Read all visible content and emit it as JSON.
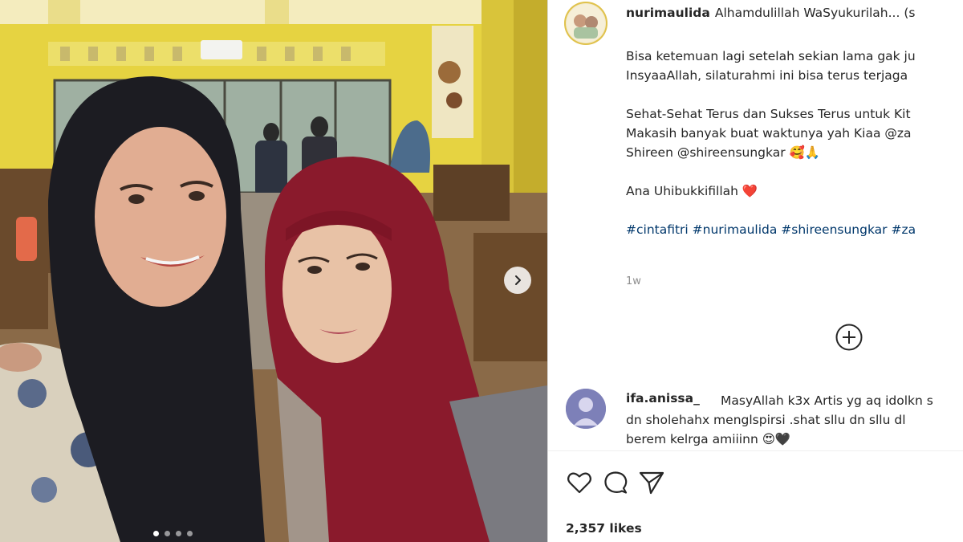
{
  "post": {
    "username": "nurimaulida",
    "caption_head": "Alhamdulillah WaSyukurilah... (s",
    "caption_lines": [
      "Bisa ketemuan lagi setelah sekian lama gak ju",
      "InsyaaAllah, silaturahmi ini bisa terus terjaga",
      "",
      "Sehat-Sehat Terus dan Sukses Terus untuk Kit",
      "Makasih banyak buat waktunya yah Kiaa @za",
      "Shireen @shireensungkar 🥰🙏",
      "",
      "Ana Uhibukkifillah ❤️",
      "",
      "#cintafitri #nurimaulida #shireensungkar #za"
    ],
    "time": "1w",
    "likes": "2,357 likes"
  },
  "comment": {
    "username": "ifa.anissa_",
    "lines": [
      "MasyAllah k3x Artis yg aq idolkn s",
      "dn sholehahx menglspirsi .shat sllu dn sllu dl",
      "berem kelrga amiiinn 😍🖤"
    ]
  },
  "icons": {
    "like": "heart-icon",
    "comment": "comment-icon",
    "share": "send-icon",
    "load_more": "plus-circle-icon",
    "next": "chevron-right-icon"
  },
  "carousel": {
    "count": 4,
    "active_index": 0
  },
  "colors": {
    "wall": "#e6d341",
    "hijab_dark": "#1c1c22",
    "hijab_red": "#8a1a2c",
    "link": "#00376b",
    "muted": "#8e8e8e"
  }
}
